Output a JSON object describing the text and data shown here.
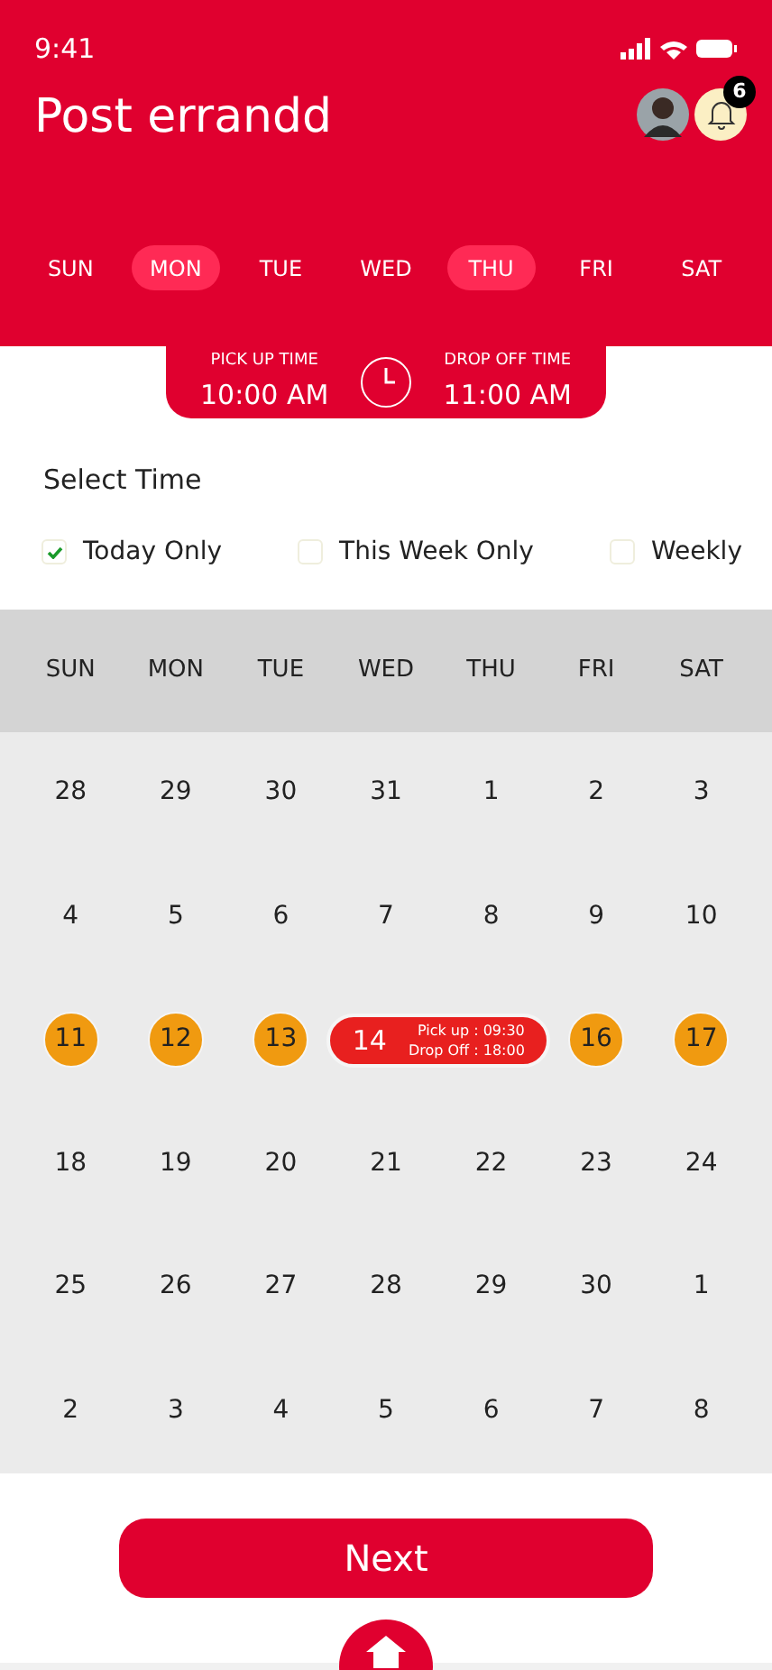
{
  "status_bar": {
    "time": "9:41"
  },
  "header": {
    "title": "Post errandd",
    "notification_count": "6"
  },
  "day_tabs": [
    {
      "label": "SUN",
      "selected": false
    },
    {
      "label": "MON",
      "selected": true
    },
    {
      "label": "TUE",
      "selected": false
    },
    {
      "label": "WED",
      "selected": false
    },
    {
      "label": "THU",
      "selected": true
    },
    {
      "label": "FRI",
      "selected": false
    },
    {
      "label": "SAT",
      "selected": false
    }
  ],
  "times": {
    "pickup_label": "PICK UP TIME",
    "pickup_value": "10:00 AM",
    "dropoff_label": "DROP OFF TIME",
    "dropoff_value": "11:00 AM"
  },
  "select_time": {
    "title": "Select Time",
    "options": [
      {
        "label": "Today Only",
        "checked": true
      },
      {
        "label": "This Week Only",
        "checked": false
      },
      {
        "label": "Weekly",
        "checked": false
      }
    ]
  },
  "calendar": {
    "weekdays": [
      "SUN",
      "MON",
      "TUE",
      "WED",
      "THU",
      "FRI",
      "SAT"
    ],
    "weeks": [
      [
        {
          "day": "28",
          "kind": "plain"
        },
        {
          "day": "29",
          "kind": "plain"
        },
        {
          "day": "30",
          "kind": "plain"
        },
        {
          "day": "31",
          "kind": "plain"
        },
        {
          "day": "1",
          "kind": "plain"
        },
        {
          "day": "2",
          "kind": "plain"
        },
        {
          "day": "3",
          "kind": "plain"
        }
      ],
      [
        {
          "day": "4",
          "kind": "plain"
        },
        {
          "day": "5",
          "kind": "plain"
        },
        {
          "day": "6",
          "kind": "plain"
        },
        {
          "day": "7",
          "kind": "plain"
        },
        {
          "day": "8",
          "kind": "plain"
        },
        {
          "day": "9",
          "kind": "plain"
        },
        {
          "day": "10",
          "kind": "plain"
        }
      ],
      [
        {
          "day": "11",
          "kind": "marked"
        },
        {
          "day": "12",
          "kind": "marked"
        },
        {
          "day": "13",
          "kind": "marked"
        },
        {
          "day": "14",
          "kind": "event",
          "pickup": "Pick up : 09:30",
          "dropoff": "Drop Off : 18:00"
        },
        {
          "day": "16",
          "kind": "marked"
        },
        {
          "day": "17",
          "kind": "marked"
        }
      ],
      [
        {
          "day": "18",
          "kind": "plain"
        },
        {
          "day": "19",
          "kind": "plain"
        },
        {
          "day": "20",
          "kind": "plain"
        },
        {
          "day": "21",
          "kind": "plain"
        },
        {
          "day": "22",
          "kind": "plain"
        },
        {
          "day": "23",
          "kind": "plain"
        },
        {
          "day": "24",
          "kind": "plain"
        }
      ],
      [
        {
          "day": "25",
          "kind": "plain"
        },
        {
          "day": "26",
          "kind": "plain"
        },
        {
          "day": "27",
          "kind": "plain"
        },
        {
          "day": "28",
          "kind": "plain"
        },
        {
          "day": "29",
          "kind": "plain"
        },
        {
          "day": "30",
          "kind": "plain"
        },
        {
          "day": "1",
          "kind": "plain"
        }
      ],
      [
        {
          "day": "2",
          "kind": "plain"
        },
        {
          "day": "3",
          "kind": "plain"
        },
        {
          "day": "4",
          "kind": "plain"
        },
        {
          "day": "5",
          "kind": "plain"
        },
        {
          "day": "6",
          "kind": "plain"
        },
        {
          "day": "7",
          "kind": "plain"
        },
        {
          "day": "8",
          "kind": "plain"
        }
      ]
    ]
  },
  "next_button": {
    "label": "Next"
  }
}
